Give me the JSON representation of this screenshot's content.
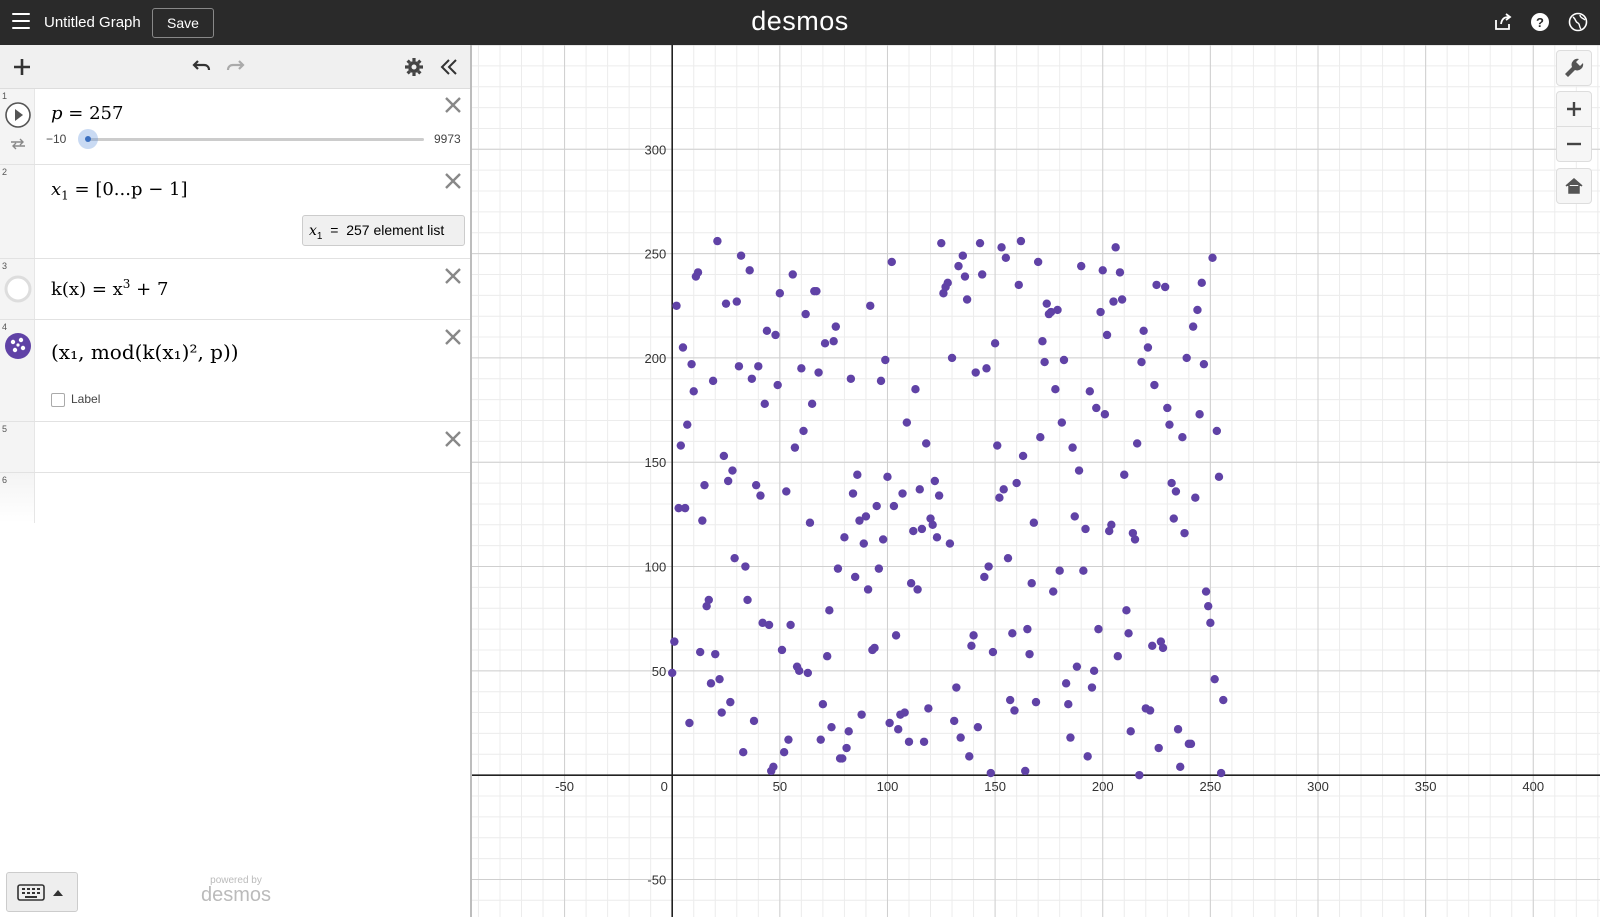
{
  "header": {
    "title": "Untitled Graph",
    "save_label": "Save",
    "brand": "desmos"
  },
  "expressions": [
    {
      "num": "1",
      "lhs": "p",
      "rhs": "257",
      "slider": {
        "min": "−10",
        "max": "9973",
        "value": 257
      }
    },
    {
      "num": "2",
      "text_lhs": "x",
      "sub": "1",
      "rhs": "[0...p − 1]",
      "eval_var": "x",
      "eval_sub": "1",
      "eval_eq": "=",
      "eval_text": "257 element list"
    },
    {
      "num": "3",
      "text": "k(x) = x",
      "sup": "3",
      "tail": " + 7"
    },
    {
      "num": "4",
      "text": "(x₁, mod(k(x₁)², p))",
      "label_text": "Label"
    },
    {
      "num": "5"
    },
    {
      "num": "6"
    }
  ],
  "footer": {
    "powered_small": "powered by",
    "powered_big": "desmos"
  },
  "colors": {
    "point": "#6042a6",
    "axis": "#222222"
  },
  "chart_data": {
    "type": "scatter",
    "series": [
      {
        "name": "",
        "color": "#6042a6"
      }
    ],
    "x_tick_labels": [
      "-50",
      "0",
      "50",
      "100",
      "150",
      "200",
      "250",
      "300",
      "350",
      "400"
    ],
    "y_tick_labels": [
      "300",
      "250",
      "200",
      "150",
      "100",
      "50",
      "-50"
    ],
    "xlim": [
      -93,
      431
    ],
    "ylim": [
      -68,
      350
    ],
    "grid": true,
    "formula": "(x, mod((x^3+7)^2, 257)) for x in 0..256",
    "modulus": 257
  }
}
